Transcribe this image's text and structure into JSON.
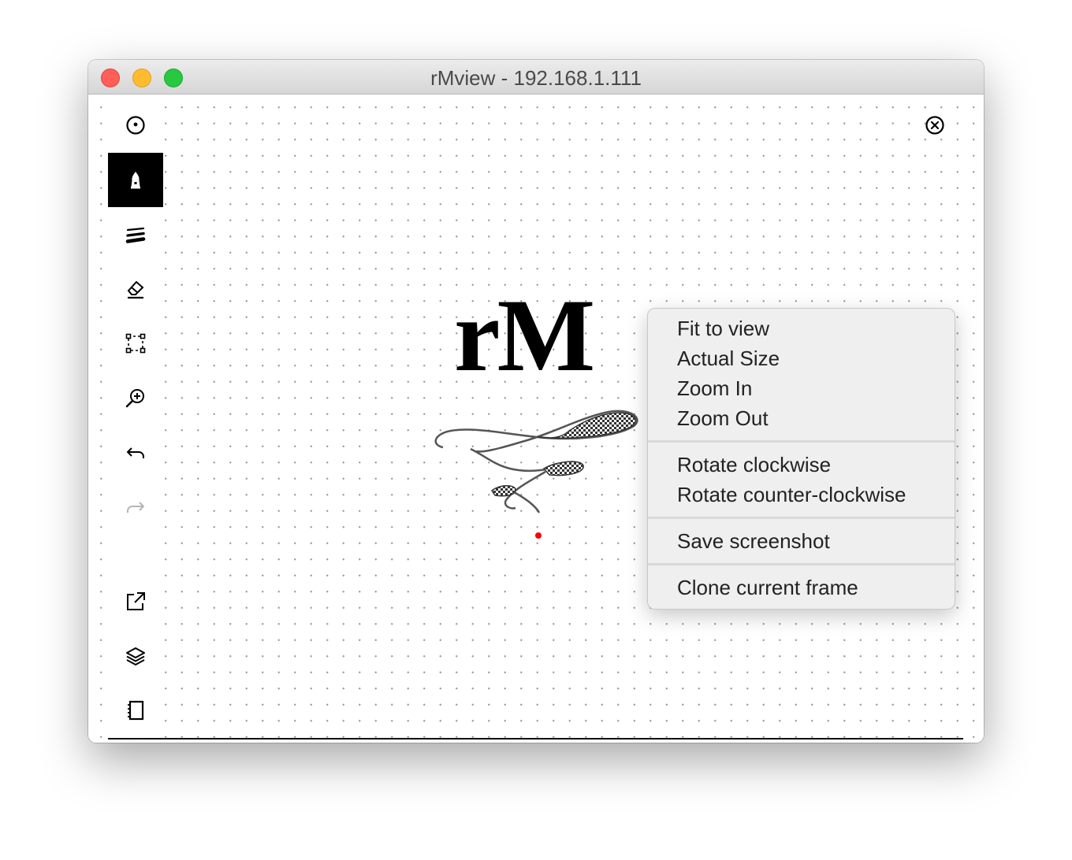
{
  "window": {
    "title": "rMview - 192.168.1.111"
  },
  "toolbar": {
    "items": [
      {
        "name": "selection-tool",
        "icon": "circle-dot-icon",
        "active": false
      },
      {
        "name": "pen-tool",
        "icon": "pen-nib-icon",
        "active": true
      },
      {
        "name": "stroke-width-tool",
        "icon": "lines-icon",
        "active": false
      },
      {
        "name": "eraser-tool",
        "icon": "eraser-icon",
        "active": false
      },
      {
        "name": "select-area-tool",
        "icon": "selection-box-icon",
        "active": false
      },
      {
        "name": "zoom-tool",
        "icon": "zoom-in-icon",
        "active": false
      },
      {
        "name": "undo-button",
        "icon": "undo-icon",
        "active": false
      },
      {
        "name": "redo-button",
        "icon": "redo-icon",
        "active": false,
        "disabled": true
      },
      {
        "name": "share-button",
        "icon": "external-link-icon",
        "active": false
      },
      {
        "name": "layers-button",
        "icon": "layers-icon",
        "active": false
      },
      {
        "name": "notebook-button",
        "icon": "notebook-icon",
        "active": false
      }
    ]
  },
  "canvas": {
    "logo_text": "rM",
    "cursor_color": "#ff0000"
  },
  "context_menu": {
    "groups": [
      [
        "Fit to view",
        "Actual Size",
        "Zoom In",
        "Zoom Out"
      ],
      [
        "Rotate clockwise",
        "Rotate counter-clockwise"
      ],
      [
        "Save screenshot"
      ],
      [
        "Clone current frame"
      ]
    ]
  },
  "colors": {
    "close": "#ff5f57",
    "minimize": "#febc2e",
    "zoom": "#28c840",
    "menu_bg": "#efefef",
    "active_tool_bg": "#000000"
  }
}
